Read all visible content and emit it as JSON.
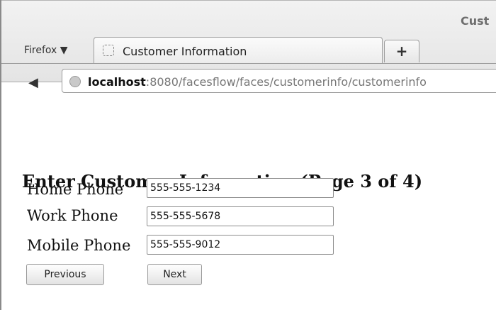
{
  "window": {
    "title": "Cust"
  },
  "toolbar": {
    "firefox_menu": "Firefox ▼",
    "tab_title": "Customer Information",
    "newtab_label": "+"
  },
  "urlbar": {
    "host": "localhost",
    "rest": ":8080/facesflow/faces/customerinfo/customerinfo"
  },
  "page": {
    "heading": "Enter Customer Information (Page 3 of 4)",
    "fields": [
      {
        "label": "Home Phone",
        "value": "555-555-1234"
      },
      {
        "label": "Work Phone",
        "value": "555-555-5678"
      },
      {
        "label": "Mobile Phone",
        "value": "555-555-9012"
      }
    ],
    "buttons": {
      "previous": "Previous",
      "next": "Next"
    }
  }
}
